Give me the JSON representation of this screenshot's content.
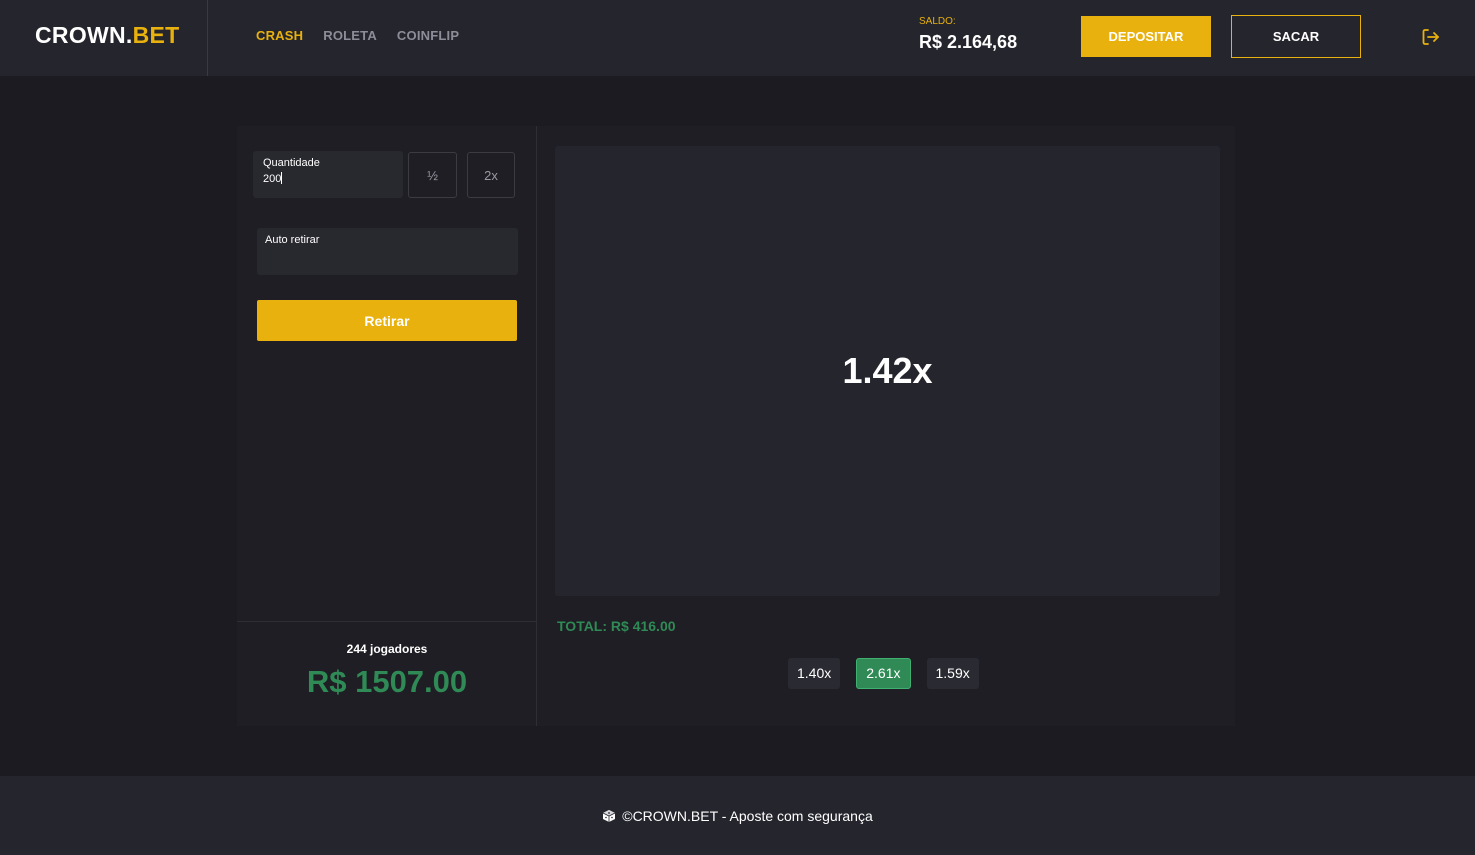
{
  "header": {
    "logo_main": "CROWN.",
    "logo_accent": "BET",
    "nav": [
      {
        "label": "CRASH",
        "active": true
      },
      {
        "label": "ROLETA",
        "active": false
      },
      {
        "label": "COINFLIP",
        "active": false
      }
    ],
    "balance_label": "SALDO:",
    "balance_value": "R$ 2.164,68",
    "deposit_label": "DEPOSITAR",
    "withdraw_label": "SACAR",
    "logout_icon": "logout-icon"
  },
  "bet": {
    "quantity_label": "Quantidade",
    "quantity_value": "200",
    "half_label": "½",
    "double_label": "2x",
    "auto_label": "Auto retirar",
    "auto_value": "",
    "cashout_label": "Retirar"
  },
  "stats": {
    "players": "244 jogadores",
    "pot": "R$ 1507.00"
  },
  "game": {
    "multiplier": "1.42x",
    "total": "TOTAL: R$ 416.00",
    "history": [
      {
        "label": "1.40x",
        "win": false
      },
      {
        "label": "2.61x",
        "win": true
      },
      {
        "label": "1.59x",
        "win": false
      }
    ]
  },
  "footer": {
    "text": "©CROWN.BET - Aposte com segurança",
    "icon": "dice-icon"
  },
  "colors": {
    "accent": "#e8b10e",
    "success": "#2f8a55",
    "background": "#1b1b21",
    "surface": "#25252d"
  }
}
